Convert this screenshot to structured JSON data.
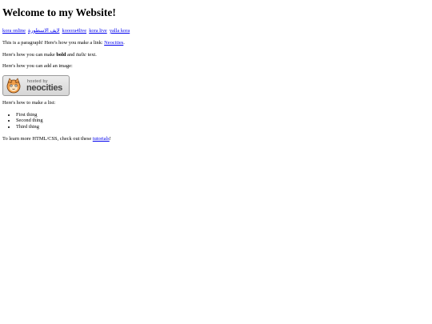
{
  "heading": "Welcome to my Website!",
  "links": [
    {
      "label": "kora online"
    },
    {
      "label": "لايف الاسطورة"
    },
    {
      "label": "kooora4live"
    },
    {
      "label": "kora live"
    },
    {
      "label": "yalla kora"
    }
  ],
  "paragraph": {
    "text": "This is a paragraph! Here's how you make a link: ",
    "link_label": "Neocities",
    "end": "."
  },
  "formatting": {
    "prefix": "Here's how you can make ",
    "bold": "bold",
    "middle": " and ",
    "italic": "italic",
    "suffix": " text."
  },
  "image_intro": "Here's how you can add an image:",
  "badge": {
    "small_text": "hosted by",
    "big_text": "neocities",
    "icon": "neocities-cat-logo"
  },
  "list_intro": "Here's how to make a list:",
  "list_items": [
    "First thing",
    "Second thing",
    "Third thing"
  ],
  "outro": {
    "prefix": "To learn more HTML/CSS, check out these ",
    "link_label": "tutorials",
    "suffix": "!"
  },
  "colors": {
    "link": "#0000ee",
    "text": "#000000",
    "background": "#ffffff"
  }
}
